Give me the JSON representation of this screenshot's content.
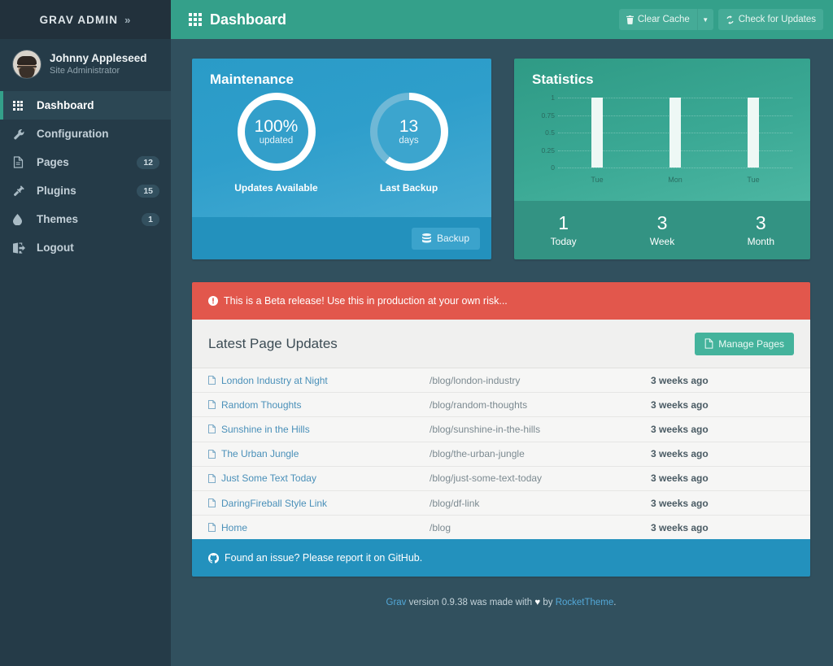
{
  "sidebar": {
    "brand": "GRAV ADMIN",
    "brand_chevron": "»",
    "user": {
      "name": "Johnny Appleseed",
      "role": "Site Administrator"
    },
    "items": [
      {
        "label": "Dashboard",
        "icon": "grid-icon",
        "badge": "",
        "active": true
      },
      {
        "label": "Configuration",
        "icon": "wrench-icon",
        "badge": "",
        "active": false
      },
      {
        "label": "Pages",
        "icon": "file-icon",
        "badge": "12",
        "active": false
      },
      {
        "label": "Plugins",
        "icon": "plug-icon",
        "badge": "15",
        "active": false
      },
      {
        "label": "Themes",
        "icon": "droplet-icon",
        "badge": "1",
        "active": false
      },
      {
        "label": "Logout",
        "icon": "sign-out-icon",
        "badge": "",
        "active": false
      }
    ]
  },
  "topbar": {
    "title": "Dashboard",
    "title_icon": "grid-icon",
    "clear_cache_label": "Clear Cache",
    "clear_cache_icon": "trash-icon",
    "caret_icon": "chevron-down-icon",
    "check_updates_label": "Check for Updates",
    "check_updates_icon": "refresh-icon"
  },
  "maintenance": {
    "title": "Maintenance",
    "updates": {
      "value": "100%",
      "unit": "updated",
      "caption": "Updates Available",
      "percent": 100
    },
    "backup": {
      "value": "13",
      "unit": "days",
      "caption": "Last Backup",
      "percent": 60
    },
    "backup_button": {
      "label": "Backup",
      "icon": "database-icon"
    }
  },
  "statistics": {
    "title": "Statistics",
    "footer": [
      {
        "number": "1",
        "label": "Today"
      },
      {
        "number": "3",
        "label": "Week"
      },
      {
        "number": "3",
        "label": "Month"
      }
    ]
  },
  "chart_data": {
    "type": "bar",
    "title": "Statistics",
    "categories": [
      "Tue",
      "Mon",
      "Tue"
    ],
    "values": [
      1,
      1,
      1
    ],
    "xlabel": "",
    "ylabel": "",
    "ylim": [
      0,
      1
    ],
    "yticks": [
      "1",
      "0.75",
      "0.5",
      "0.25",
      "0"
    ],
    "ytick_values": [
      1,
      0.75,
      0.5,
      0.25,
      0
    ],
    "grid": true,
    "legend": false,
    "bar_color": "#eef8f5",
    "plot_bg": "#3aa894"
  },
  "alert": {
    "icon": "exclamation-circle-icon",
    "text": "This is a Beta release! Use this in production at your own risk..."
  },
  "updates_panel": {
    "title": "Latest Page Updates",
    "manage_button": {
      "label": "Manage Pages",
      "icon": "file-icon"
    },
    "rows": [
      {
        "icon": "page-icon",
        "title": "London Industry at Night",
        "url": "/blog/london-industry",
        "time": "3 weeks ago"
      },
      {
        "icon": "page-icon",
        "title": "Random Thoughts",
        "url": "/blog/random-thoughts",
        "time": "3 weeks ago"
      },
      {
        "icon": "page-icon",
        "title": "Sunshine in the Hills",
        "url": "/blog/sunshine-in-the-hills",
        "time": "3 weeks ago"
      },
      {
        "icon": "page-icon",
        "title": "The Urban Jungle",
        "url": "/blog/the-urban-jungle",
        "time": "3 weeks ago"
      },
      {
        "icon": "page-icon",
        "title": "Just Some Text Today",
        "url": "/blog/just-some-text-today",
        "time": "3 weeks ago"
      },
      {
        "icon": "page-icon",
        "title": "DaringFireball Style Link",
        "url": "/blog/df-link",
        "time": "3 weeks ago"
      },
      {
        "icon": "page-icon",
        "title": "Home",
        "url": "/blog",
        "time": "3 weeks ago"
      }
    ]
  },
  "github_bar": {
    "icon": "github-icon",
    "text": "Found an issue? Please report it on GitHub."
  },
  "credit": {
    "grav": "Grav",
    "middle": " version 0.9.38 was made with ",
    "heart": "♥",
    "by": " by ",
    "rockettheme": "RocketTheme",
    "period": "."
  },
  "colors": {
    "brand_green": "#34a08a",
    "sidebar": "#253b48",
    "page_bg": "#31505e",
    "maintenance_blue": "#2e9ecb",
    "alert_red": "#e2574c",
    "link_blue": "#4a90b9",
    "github_blue": "#2391bd"
  }
}
